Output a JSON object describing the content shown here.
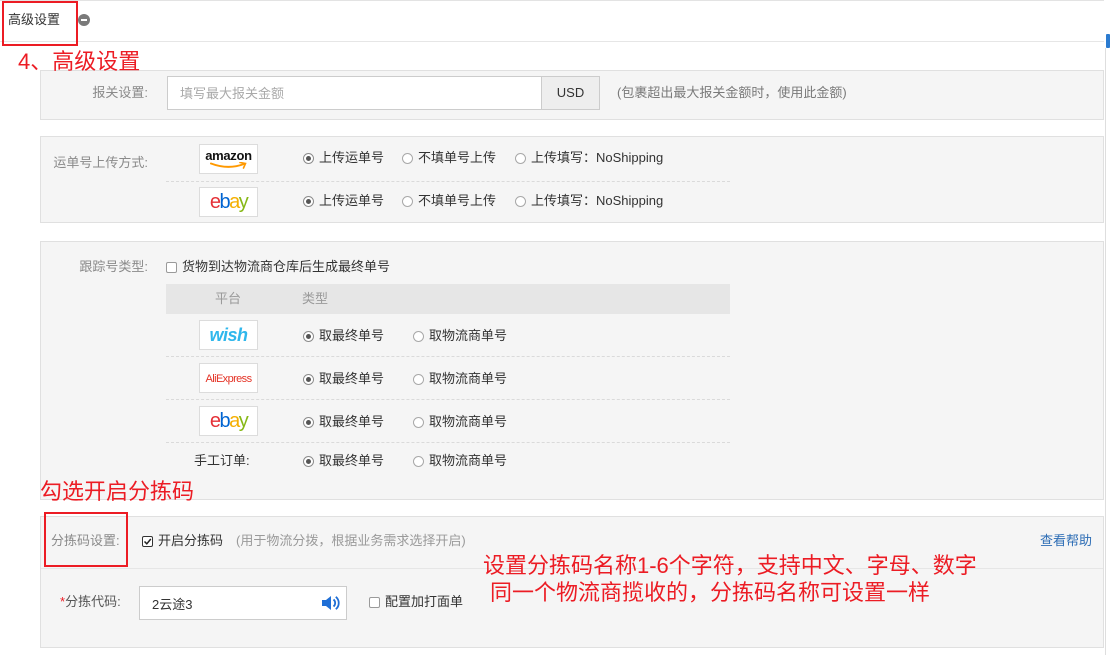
{
  "header": {
    "title": "高级设置"
  },
  "annotations": {
    "step_title": "4、高级设置",
    "check_hint": "勾选开启分拣码",
    "name_hint_line1": "设置分拣码名称1-6个字符，支持中文、字母、数字",
    "name_hint_line2": "同一个物流商揽收的，分拣码名称可设置一样"
  },
  "customs": {
    "label": "报关设置:",
    "amount_value": "",
    "amount_placeholder": "填写最大报关金额",
    "currency": "USD",
    "note": "(包裹超出最大报关金额时，使用此金额)"
  },
  "waybill_upload": {
    "label": "运单号上传方式:",
    "rows": [
      {
        "logo": {
          "text": "amazon",
          "color": "#111111"
        },
        "options": [
          "上传运单号",
          "不填单号上传",
          "上传填写：NoShipping"
        ],
        "selected": 0
      },
      {
        "logo": {
          "text": "ebay",
          "letter_colors": [
            "#e53238",
            "#0064d2",
            "#f5af02",
            "#86b817"
          ]
        },
        "options": [
          "上传运单号",
          "不填单号上传",
          "上传填写：NoShipping"
        ],
        "selected": 0
      }
    ]
  },
  "tracking": {
    "label": "跟踪号类型:",
    "final_number_checkbox": {
      "label": "货物到达物流商仓库后生成最终单号",
      "checked": false
    },
    "columns": [
      "平台",
      "类型"
    ],
    "rows": [
      {
        "logo": {
          "text": "wish",
          "color": "#2fb7ec"
        },
        "options": [
          "取最终单号",
          "取物流商单号"
        ],
        "selected": 0
      },
      {
        "logo": {
          "text": "AliExpress",
          "color": "#e43225"
        },
        "options": [
          "取最终单号",
          "取物流商单号"
        ],
        "selected": 0
      },
      {
        "logo": {
          "text": "ebay",
          "letter_colors": [
            "#e53238",
            "#0064d2",
            "#f5af02",
            "#86b817"
          ]
        },
        "options": [
          "取最终单号",
          "取物流商单号"
        ],
        "selected": 0
      },
      {
        "label": "手工订单:",
        "options": [
          "取最终单号",
          "取物流商单号"
        ],
        "selected": 0
      }
    ]
  },
  "sorting_code": {
    "label": "分拣码设置:",
    "enable_checkbox": {
      "label": "开启分拣码",
      "checked": true
    },
    "note": "(用于物流分拨，根据业务需求选择开启)",
    "help_link": "查看帮助",
    "required_mark": "*",
    "code_label": "分拣代码:",
    "code_value": "2云途3",
    "print_checkbox": {
      "label": "配置加打面单",
      "checked": false
    }
  },
  "icons": {
    "collapse": "collapse-icon",
    "speaker": "speaker-icon",
    "amazon_smile": "amazon-smile-icon"
  },
  "colors": {
    "annotation_red": "#ec1c24",
    "link_blue": "#2d6db5",
    "panel_background": "#f5f5f5",
    "speaker_blue": "#1f6fd6"
  }
}
